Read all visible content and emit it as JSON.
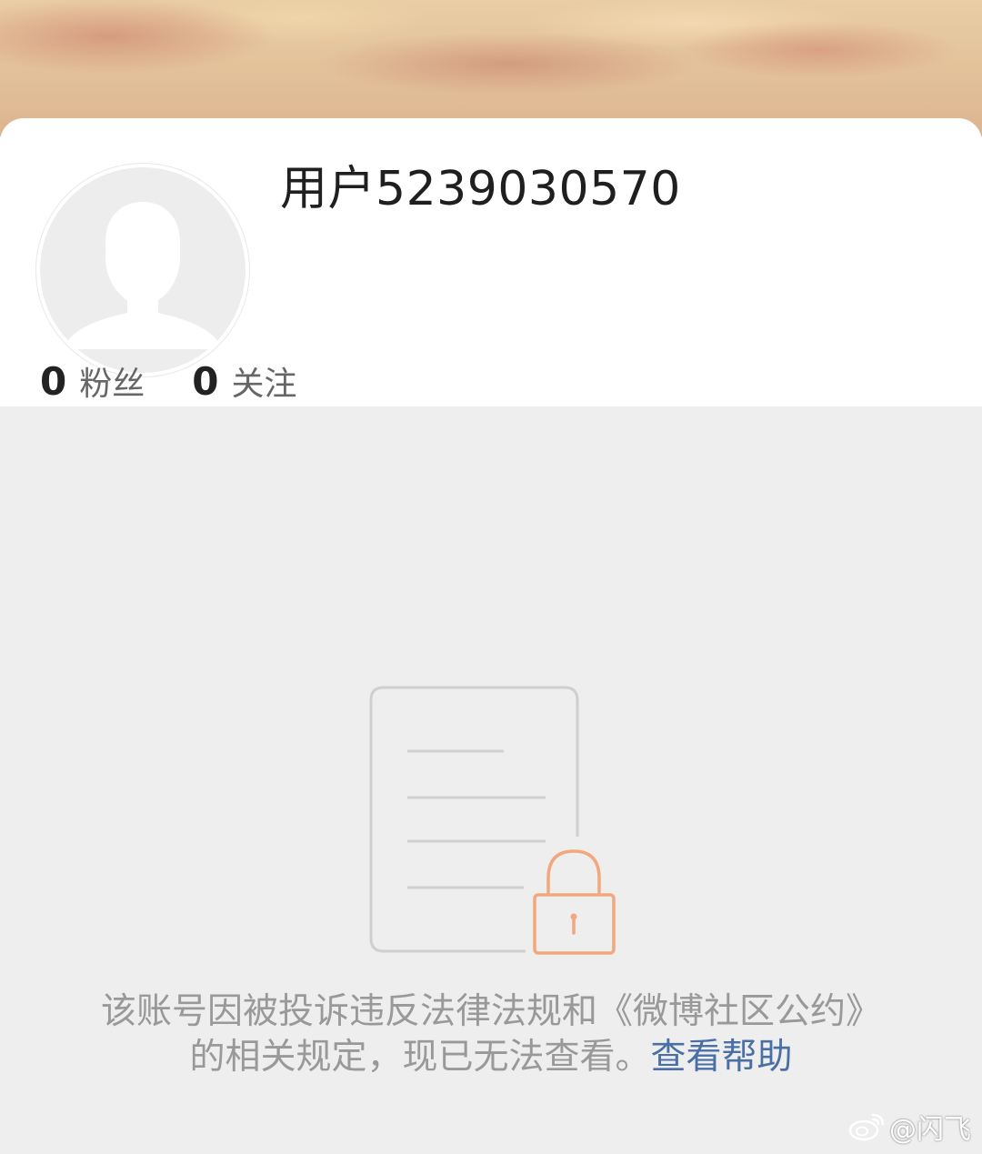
{
  "profile": {
    "username": "用户5239030570",
    "avatar_icon": "default-avatar-silhouette-icon"
  },
  "stats": [
    {
      "count": "0",
      "label": "粉丝"
    },
    {
      "count": "0",
      "label": "关注"
    }
  ],
  "notice": {
    "icon": "locked-document-icon",
    "text": "该账号因被投诉违反法律法规和《微博社区公约》的相关规定，现已无法查看。",
    "link_label": "查看帮助"
  },
  "watermark": {
    "icon": "weibo-logo-icon",
    "text": "@闪飞"
  },
  "colors": {
    "link": "#4a6fa5",
    "lock_accent": "#f3a77c",
    "page_background": "#eeeeee"
  }
}
